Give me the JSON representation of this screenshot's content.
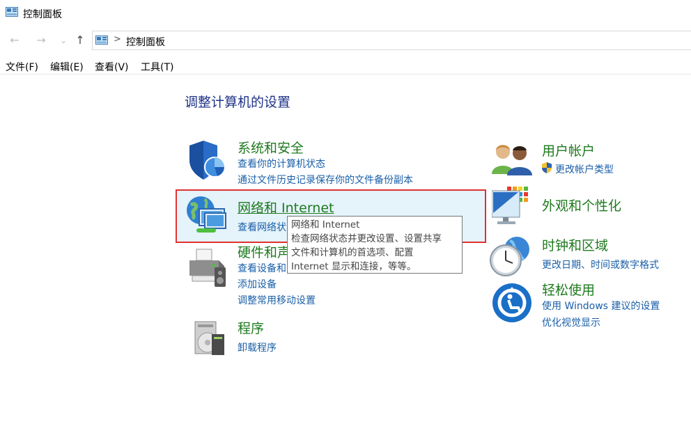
{
  "window": {
    "title": "控制面板"
  },
  "address_bar": {
    "breadcrumb": "控制面板",
    "separator": ">"
  },
  "nav": {
    "back": "←",
    "forward": "→",
    "recent": "⌄",
    "up": "↑"
  },
  "menu": {
    "file": "文件(F)",
    "edit": "编辑(E)",
    "view": "查看(V)",
    "tools": "工具(T)"
  },
  "main": {
    "heading": "调整计算机的设置"
  },
  "categories": {
    "system_security": {
      "title": "系统和安全",
      "links": [
        "查看你的计算机状态",
        "通过文件历史记录保存你的文件备份副本"
      ]
    },
    "network": {
      "title": "网络和 Internet",
      "links": [
        "查看网络状"
      ]
    },
    "hardware": {
      "title": "硬件和声",
      "links": [
        "查看设备和",
        "添加设备",
        "调整常用移动设置"
      ]
    },
    "programs": {
      "title": "程序",
      "links": [
        "卸载程序"
      ]
    },
    "user_accounts": {
      "title": "用户帐户",
      "links": [
        "更改帐户类型"
      ]
    },
    "appearance": {
      "title": "外观和个性化",
      "links": []
    },
    "clock_region": {
      "title": "时钟和区域",
      "links": [
        "更改日期、时间或数字格式"
      ]
    },
    "ease_of_access": {
      "title": "轻松使用",
      "links": [
        "使用 Windows 建议的设置",
        "优化视觉显示"
      ]
    }
  },
  "tooltip": {
    "lines": [
      "网络和 Internet",
      "检查网络状态并更改设置、设置共享",
      "文件和计算机的首选项、配置",
      "Internet 显示和连接，等等。"
    ]
  },
  "colors": {
    "heading": "#1e3287",
    "category_title": "#1e7a1e",
    "link": "#1a5fa8",
    "highlight_border": "#e0312f",
    "hover_bg": "#e5f3fb"
  }
}
